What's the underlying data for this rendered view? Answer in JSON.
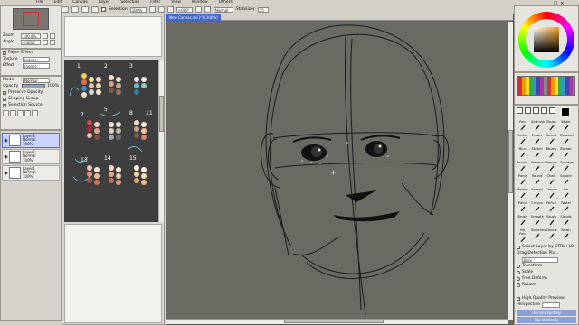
{
  "menubar": [
    "File",
    "Edit",
    "Canvas",
    "Layer",
    "Selection",
    "Filter",
    "View",
    "Window",
    "Others"
  ],
  "toolbar": {
    "selection_label": "Selection",
    "zoom": "100%",
    "angle": "+000°",
    "blend_mode": "Normal",
    "stabilizer_label": "Stabilizer",
    "stabilizer_value": "15"
  },
  "navigator": {
    "zoom_label": "Zoom",
    "zoom_value": "100.0%",
    "angle_label": "Angle",
    "angle_value": "+0000"
  },
  "paper_effect": {
    "title": "Paper Effect",
    "texture_label": "Texture",
    "texture_value": "(none)",
    "effect_label": "Effect",
    "effect_value": "(none)"
  },
  "layer_props": {
    "mode_label": "Mode",
    "mode_value": "Normal",
    "opacity_label": "Opacity",
    "opacity_value": "100%",
    "preserve_opacity": "Preserve Opacity",
    "clipping_group": "Clipping Group",
    "selection_source": "Selection Source"
  },
  "layers": [
    {
      "name": "Layer3",
      "mode": "Normal",
      "opacity": "100%",
      "selected": true
    },
    {
      "name": "Layer2",
      "mode": "Normal",
      "opacity": "100%",
      "selected": false
    },
    {
      "name": "Layer1",
      "mode": "Normal",
      "opacity": "100%",
      "selected": false
    }
  ],
  "canvas_tab": "New Canvas.sai [*] (100%)",
  "palette_numbers": [
    "1",
    "2",
    "3",
    "5",
    "7",
    "8",
    "13",
    "14",
    "15",
    "11"
  ],
  "tools": [
    [
      "Pen",
      "AirBrush",
      "Brush",
      "Water"
    ],
    [
      "Marker",
      "Eraser",
      "Select",
      "Deselect"
    ],
    [
      "Blur",
      "Sketch",
      "Binary",
      "Bucket"
    ],
    [
      "Acrylic",
      "Watercolor",
      "Crayon",
      "Smudge"
    ],
    [
      "Paint",
      "Round",
      "Chalk",
      "Square"
    ],
    [
      "Marker",
      "Spread",
      "Crayon",
      "Ink"
    ],
    [
      "Paint",
      "Crayon",
      "Pencil",
      "Pastel"
    ],
    [
      "Brush",
      "Smooth",
      "Brush",
      "Clouds"
    ],
    [
      "Ink Pen",
      "Sketching",
      "Clouds",
      "Brush"
    ]
  ],
  "right_options": {
    "select_layer": "Select Layer by CTRL+LB",
    "drag_detection": "Drag Detection Pix...",
    "drag_value": "8pix",
    "transform": "Transform",
    "scale": "Scale",
    "free_deform": "Free Deform",
    "rotate": "Rotate",
    "hq_preview": "High Quality Preview",
    "perspective_label": "Perspective",
    "flip_h": "Flip Horizontally",
    "flip_v": "Flip Vertically"
  },
  "colors": {
    "canvas_bg": "#6a6a62",
    "panel_bg": "#e6e4df",
    "selected_layer": "#c8d4ff",
    "flip_button": "#8aa0d8"
  }
}
